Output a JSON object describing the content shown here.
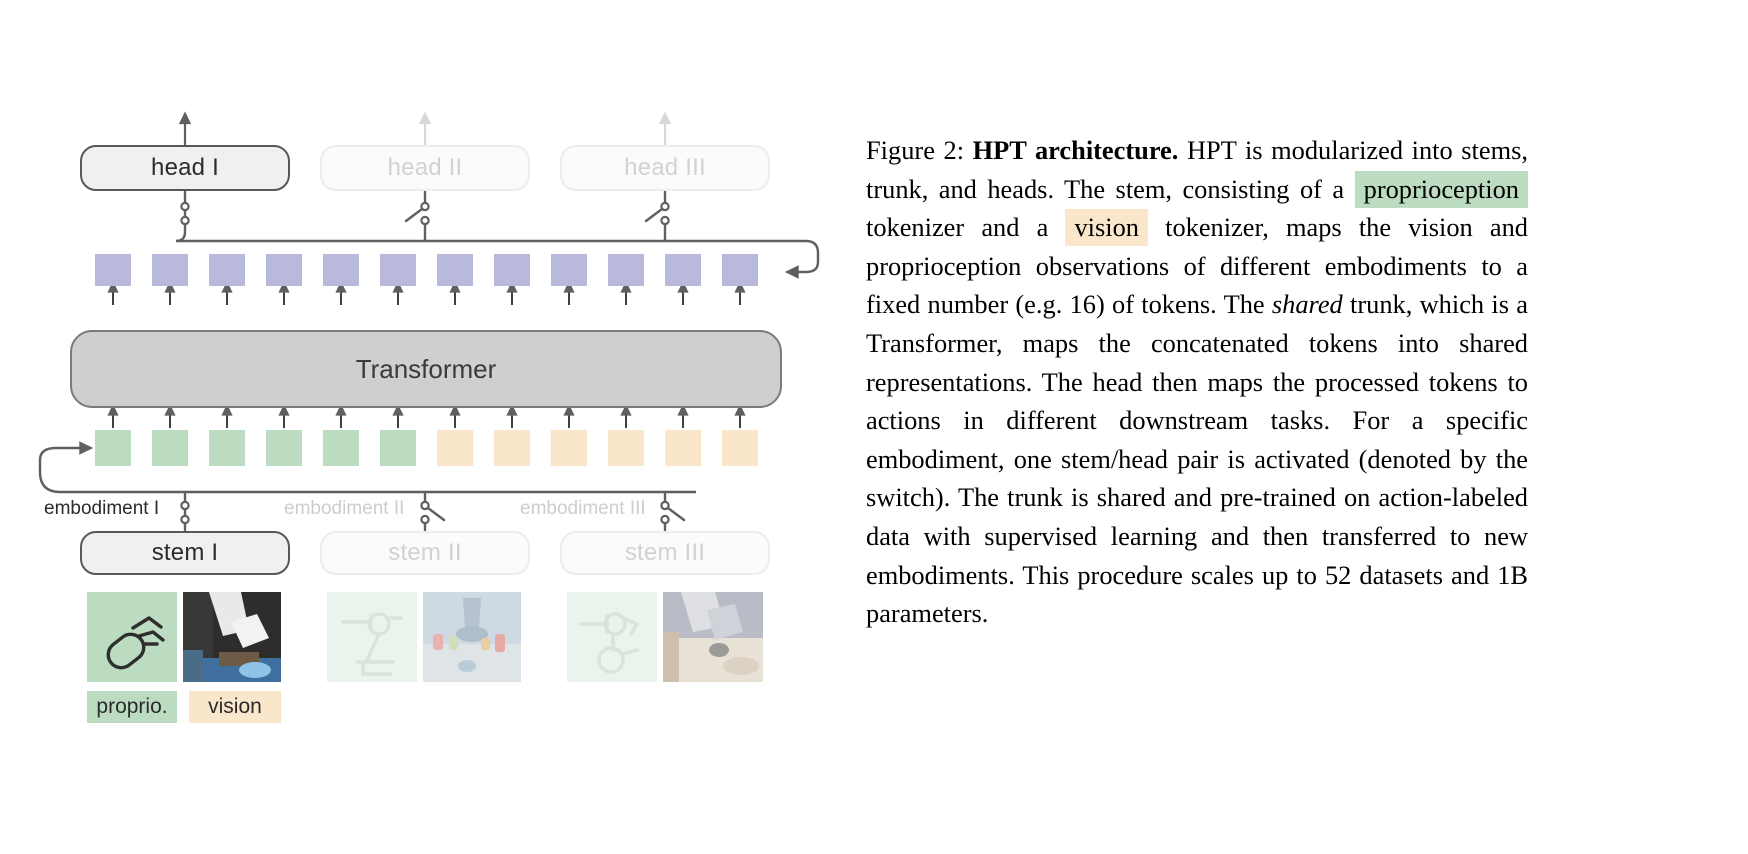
{
  "figure": {
    "heads": [
      {
        "label": "head I",
        "state": "active"
      },
      {
        "label": "head II",
        "state": "inactive"
      },
      {
        "label": "head III",
        "state": "inactive"
      }
    ],
    "trunk": {
      "label": "Transformer"
    },
    "embodiments": [
      {
        "label": "embodiment I",
        "state": "active"
      },
      {
        "label": "embodiment II",
        "state": "inactive"
      },
      {
        "label": "embodiment III",
        "state": "inactive"
      }
    ],
    "stems": [
      {
        "label": "stem I",
        "state": "active"
      },
      {
        "label": "stem II",
        "state": "inactive"
      },
      {
        "label": "stem III",
        "state": "inactive"
      }
    ],
    "legend": [
      {
        "label": "proprio.",
        "color": "#bcdcc1"
      },
      {
        "label": "vision",
        "color": "#fae7cb"
      }
    ],
    "tokens": {
      "output_count": 12,
      "output_color": "#b9b9db",
      "input_proprio_count": 6,
      "input_proprio_color": "#bcdcc1",
      "input_vision_count": 6,
      "input_vision_color": "#fae7cb"
    },
    "colors": {
      "trunk_fill": "#cfcfcf",
      "trunk_stroke": "#7a7a7a",
      "active_stroke": "#585858",
      "inactive_stroke": "#ededed",
      "wire": "#5f5f5f",
      "wire_faded": "#d8d8d8"
    }
  },
  "caption": {
    "figure_number": "Figure 2:",
    "title": "HPT architecture.",
    "part1": " HPT is modularized into stems, trunk, and heads. The stem, consisting of a ",
    "highlight1": "proprioception",
    "part2": " tokenizer and a ",
    "highlight2": "vision",
    "part3": " tokenizer, maps the vision and proprioception observations of different embodiments to a fixed number (e.g. 16) of tokens. The ",
    "emphasis": "shared",
    "part4": " trunk, which is a Transformer, maps the concatenated tokens into shared representations. The head then maps the processed tokens to actions in different downstream tasks. For a specific embodiment, one stem/head pair is activated (denoted by the switch). The trunk is shared and pre-trained on action-labeled data with supervised learning and then transferred to new embodiments. This procedure scales up to 52 datasets and 1B parameters."
  }
}
